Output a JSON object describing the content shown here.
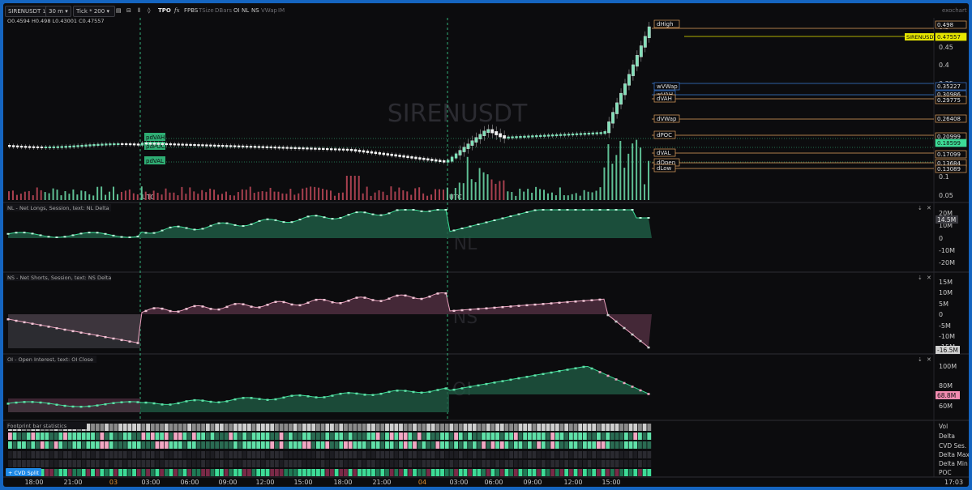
{
  "toolbar": {
    "symbol": "SIRENUSDT",
    "symbol_badge": "1",
    "timeframe": "30 m",
    "bar_type": "Tick * 200",
    "tpo": "TPO",
    "fx": "fx",
    "fpbs": "FPBS",
    "tsize": "TSize",
    "dbars": "DBars",
    "oi": "OI",
    "nl": "NL",
    "ns": "NS",
    "vwap": "VWap",
    "im": "IM",
    "brand": "exochart"
  },
  "ohlc": {
    "o": "O0.4594",
    "h": "H0.498",
    "l": "L0.43001",
    "c": "C0.47557"
  },
  "main": {
    "watermark": "SIRENUSDT",
    "utc1": "UTC",
    "utc2": "UTC",
    "left_levels": [
      "pdVAH",
      "pdPOC",
      "pdVAL"
    ],
    "level_labels": [
      "dHigh",
      "wVWap",
      "wVAH",
      "dVAH",
      "dVWap",
      "dPOC",
      "dVAL",
      "dOpen",
      "dLow"
    ],
    "price_axis": [
      "0.5",
      "0.45",
      "0.4",
      "0.35",
      "0.1",
      "0.05"
    ],
    "price_tags": [
      {
        "label": "0.498",
        "kind": "hl"
      },
      {
        "label": "0.47557",
        "kind": "last"
      },
      {
        "label": "0.35227",
        "kind": "blue"
      },
      {
        "label": "0.30986",
        "kind": "blue"
      },
      {
        "label": "0.29775",
        "kind": "hl"
      },
      {
        "label": "0.26408",
        "kind": "hl"
      },
      {
        "label": "0.20999",
        "kind": "hl"
      },
      {
        "label": "0.18599",
        "kind": "green"
      },
      {
        "label": "0.17099",
        "kind": "hl"
      },
      {
        "label": "0.13684",
        "kind": "hl"
      },
      {
        "label": "0.13089",
        "kind": "hl"
      }
    ],
    "symbol_tag": "SIRENUSDT"
  },
  "panes": {
    "nl": {
      "title": "NL - Net Longs, Session, text: NL Delta",
      "watermark": "NL",
      "axis": [
        "20M",
        "10M",
        "0",
        "-10M",
        "-20M"
      ],
      "last": "14.5M"
    },
    "ns": {
      "title": "NS - Net Shorts, Session, text: NS Delta",
      "watermark": "NS",
      "axis": [
        "15M",
        "10M",
        "5M",
        "0",
        "-5M",
        "-10M",
        "-15M"
      ],
      "last": "-16.5M"
    },
    "oi": {
      "title": "OI - Open Interest, text: OI Close",
      "watermark": "OI",
      "axis": [
        "100M",
        "80M",
        "60M"
      ],
      "last": "68.8M"
    },
    "fp": {
      "title": "Footprint bar statistics",
      "rows": [
        "Vol",
        "Delta",
        "CVD Ses.",
        "Delta Max",
        "Delta Min",
        "POC"
      ],
      "cvd_button": "+ CVD Split"
    }
  },
  "time_axis": {
    "labels": [
      "18:00",
      "21:00",
      "03",
      "03:00",
      "06:00",
      "09:00",
      "12:00",
      "15:00",
      "18:00",
      "21:00",
      "04",
      "03:00",
      "06:00",
      "09:00",
      "12:00",
      "15:00"
    ],
    "countdown": "17:03"
  },
  "colors": {
    "accent": "#1565c0",
    "bull": "#3ddc97",
    "bear": "#e0507a",
    "level": "#e0a060",
    "blue_level": "#3a7bd5",
    "last_price": "#e6e600"
  }
}
